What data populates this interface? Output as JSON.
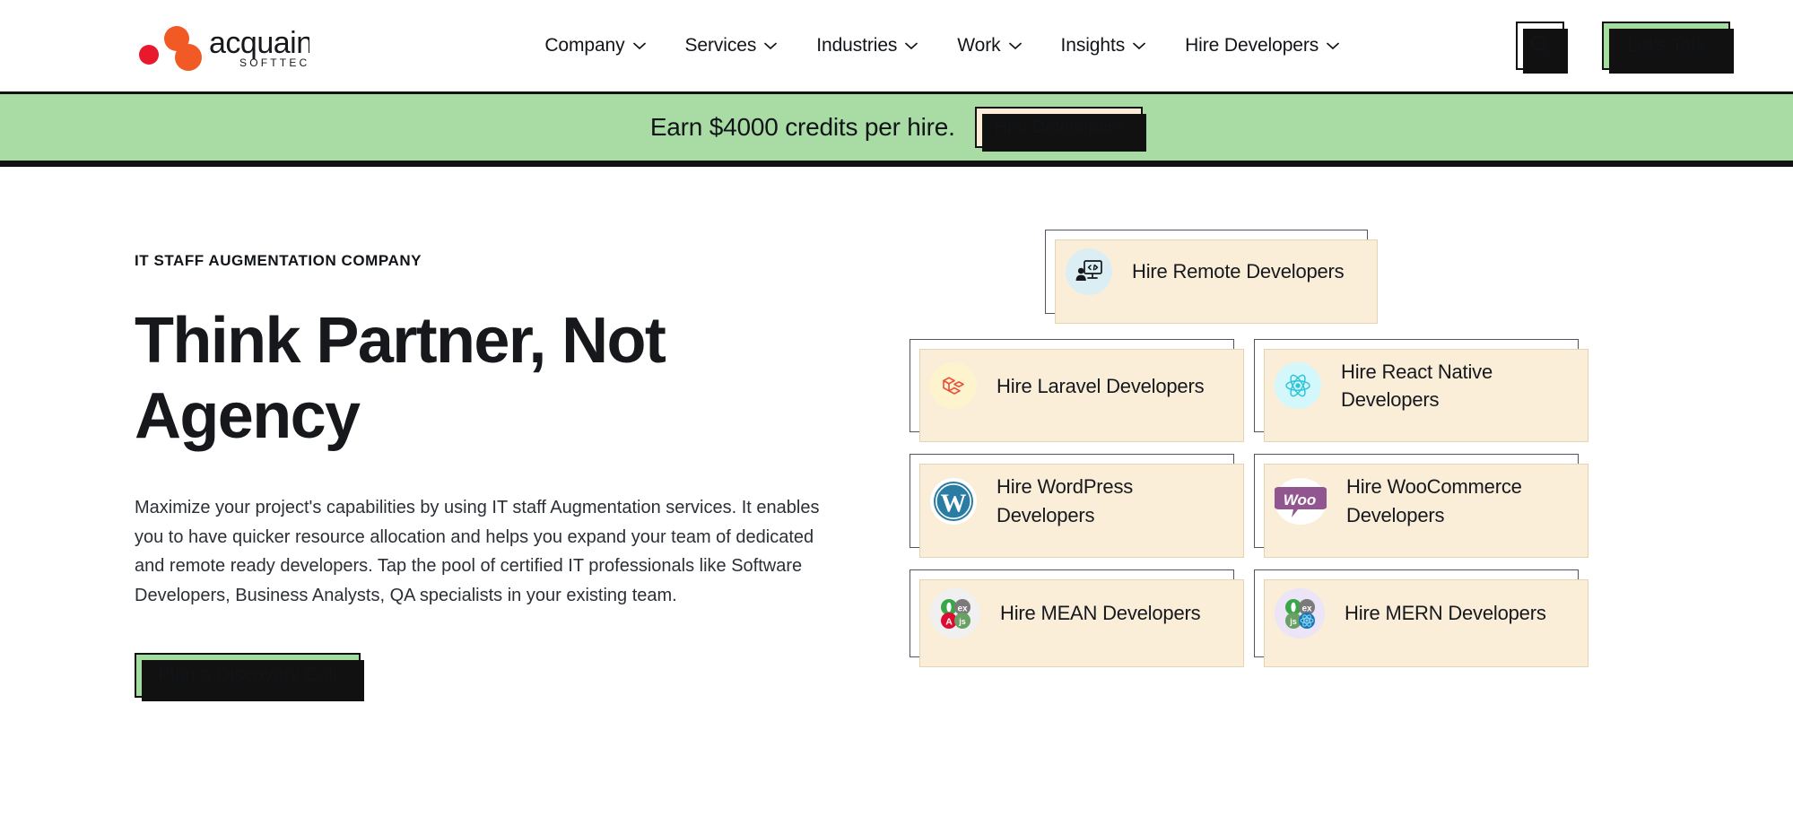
{
  "brand": {
    "name": "acquaint",
    "sub": "SOFTTECH",
    "logo_icon": "acquaint-molecule-logo"
  },
  "header": {
    "nav": [
      {
        "label": "Company",
        "icon": "chevron-down-icon"
      },
      {
        "label": "Services",
        "icon": "chevron-down-icon"
      },
      {
        "label": "Industries",
        "icon": "chevron-down-icon"
      },
      {
        "label": "Work",
        "icon": "chevron-down-icon"
      },
      {
        "label": "Insights",
        "icon": "chevron-down-icon"
      },
      {
        "label": "Hire Developers",
        "icon": "chevron-down-icon"
      }
    ],
    "search_icon": "search-icon",
    "cta_label": "Let's Talk",
    "cta_color": "#a5dda1"
  },
  "promo": {
    "text": "Earn $4000 credits per hire.",
    "button_label": "Hire Developers",
    "background": "#a9dca4",
    "button_background": "#fcecd7"
  },
  "hero": {
    "eyebrow": "IT STAFF AUGMENTATION COMPANY",
    "title": "Think Partner, Not Agency",
    "paragraph": "Maximize your project's capabilities by using IT staff Augmentation services. It enables you to have quicker resource allocation and helps you expand your team of dedicated and remote ready developers. Tap the pool of certified IT professionals like Software Developers, Business Analysts, QA specialists in your existing team.",
    "cta_label": "Plan a Discovery Call",
    "cta_color": "#a5dda1"
  },
  "cards": {
    "featured": {
      "label": "Hire Remote Developers",
      "icon": "remote-developer-screen-icon",
      "icon_bg": "#dbeef3"
    },
    "items": [
      {
        "label": "Hire Laravel Developers",
        "icon": "laravel-icon",
        "icon_bg": "#fdf3cd"
      },
      {
        "label": "Hire React Native Developers",
        "icon": "react-atom-icon",
        "icon_bg": "#d4f7fb"
      },
      {
        "label": "Hire WordPress Developers",
        "icon": "wordpress-icon",
        "icon_bg": "#ffffff"
      },
      {
        "label": "Hire WooCommerce Developers",
        "icon": "woocommerce-icon",
        "icon_bg": "#ffffff"
      },
      {
        "label": "Hire MEAN Developers",
        "icon": "mean-stack-icon",
        "icon_bg": "#f0f0f0"
      },
      {
        "label": "Hire MERN Developers",
        "icon": "mern-stack-icon",
        "icon_bg": "#ece4f7"
      }
    ],
    "shadow_color": "#fbeed8"
  }
}
